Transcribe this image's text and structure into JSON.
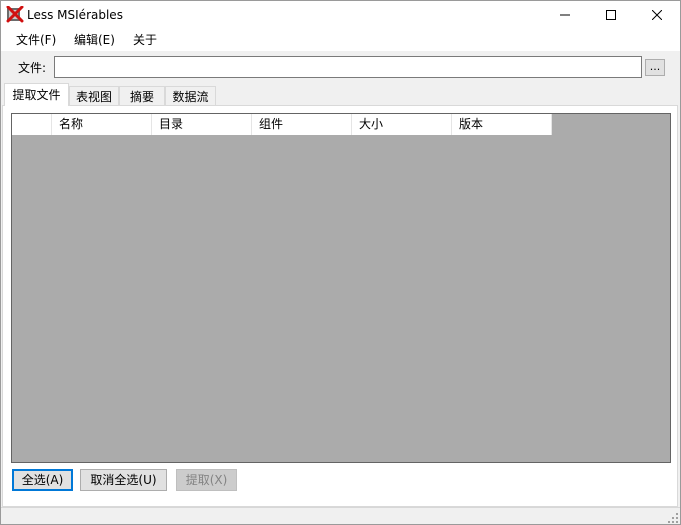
{
  "window": {
    "title": "Less MSIérables"
  },
  "menu": {
    "items": [
      {
        "label": "文件(F)"
      },
      {
        "label": "编辑(E)"
      },
      {
        "label": "关于"
      }
    ]
  },
  "file_row": {
    "label": "文件:",
    "value": "",
    "browse_label": "..."
  },
  "tabs": [
    {
      "label": "提取文件",
      "active": true
    },
    {
      "label": "表视图",
      "active": false
    },
    {
      "label": "摘要",
      "active": false
    },
    {
      "label": "数据流",
      "active": false
    }
  ],
  "list": {
    "columns": [
      "",
      "名称",
      "目录",
      "组件",
      "大小",
      "版本"
    ],
    "rows": []
  },
  "buttons": {
    "select_all": "全选(A)",
    "deselect_all": "取消全选(U)",
    "extract": "提取(X)"
  },
  "colors": {
    "list_background": "#ababab",
    "focus_border": "#0078d7"
  }
}
